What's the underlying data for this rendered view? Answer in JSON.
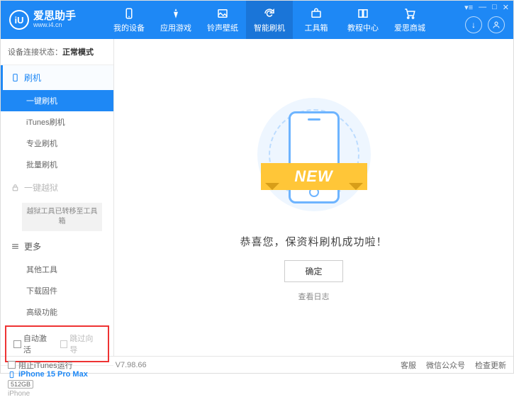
{
  "app": {
    "title": "爱思助手",
    "subtitle": "www.i4.cn",
    "logo_letter": "iU"
  },
  "nav": {
    "items": [
      {
        "label": "我的设备"
      },
      {
        "label": "应用游戏"
      },
      {
        "label": "铃声壁纸"
      },
      {
        "label": "智能刷机"
      },
      {
        "label": "工具箱"
      },
      {
        "label": "教程中心"
      },
      {
        "label": "爱思商城"
      }
    ],
    "active_index": 3
  },
  "sidebar": {
    "status_label": "设备连接状态：",
    "status_value": "正常模式",
    "sections": {
      "flash": {
        "title": "刷机",
        "items": [
          {
            "label": "一键刷机",
            "active": true
          },
          {
            "label": "iTunes刷机"
          },
          {
            "label": "专业刷机"
          },
          {
            "label": "批量刷机"
          }
        ]
      },
      "jailbreak": {
        "title": "一键越狱",
        "note": "越狱工具已转移至工具箱"
      },
      "more": {
        "title": "更多",
        "items": [
          {
            "label": "其他工具"
          },
          {
            "label": "下载固件"
          },
          {
            "label": "高级功能"
          }
        ]
      }
    },
    "checkboxes": {
      "auto_activate": "自动激活",
      "skip_guide": "跳过向导"
    },
    "device": {
      "name": "iPhone 15 Pro Max",
      "storage": "512GB",
      "type": "iPhone"
    }
  },
  "main": {
    "ribbon": "NEW",
    "success_text": "恭喜您，保资料刷机成功啦！",
    "ok_button": "确定",
    "view_log": "查看日志"
  },
  "footer": {
    "block_itunes": "阻止iTunes运行",
    "version": "V7.98.66",
    "links": [
      "客服",
      "微信公众号",
      "检查更新"
    ]
  }
}
